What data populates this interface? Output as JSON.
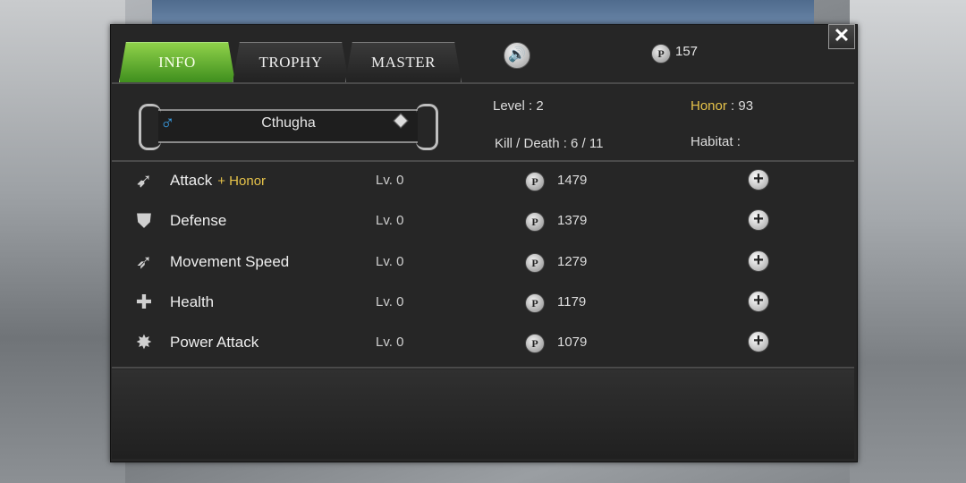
{
  "tabs": [
    {
      "label": "INFO",
      "active": true
    },
    {
      "label": "TROPHY",
      "active": false
    },
    {
      "label": "MASTER",
      "active": false
    }
  ],
  "currency": {
    "icon": "p-coin-icon",
    "symbol": "P",
    "amount": "157"
  },
  "sound_icon": "speaker-icon",
  "close_icon": "close-icon",
  "character": {
    "gender_symbol": "♂",
    "name": "Cthugha"
  },
  "stats": {
    "level_label": "Level :",
    "level_value": "2",
    "honor_label": "Honor",
    "honor_value": ": 93",
    "kd_label": "Kill / Death :",
    "kd_value": "6 / 11",
    "habitat_label": "Habitat :"
  },
  "upgrades": [
    {
      "icon": "claw-icon",
      "name": "Attack",
      "bonus": "+ Honor",
      "level": "Lv. 0",
      "cost": "1479"
    },
    {
      "icon": "shield-icon",
      "name": "Defense",
      "bonus": "",
      "level": "Lv. 0",
      "cost": "1379"
    },
    {
      "icon": "wing-icon",
      "name": "Movement Speed",
      "bonus": "",
      "level": "Lv. 0",
      "cost": "1279"
    },
    {
      "icon": "cross-icon",
      "name": "Health",
      "bonus": "",
      "level": "Lv. 0",
      "cost": "1179"
    },
    {
      "icon": "burst-icon",
      "name": "Power Attack",
      "bonus": "",
      "level": "Lv. 0",
      "cost": "1079"
    }
  ],
  "colors": {
    "active_tab": "#5fb52f",
    "honor": "#e6c34a",
    "gender": "#3aa0e8"
  }
}
